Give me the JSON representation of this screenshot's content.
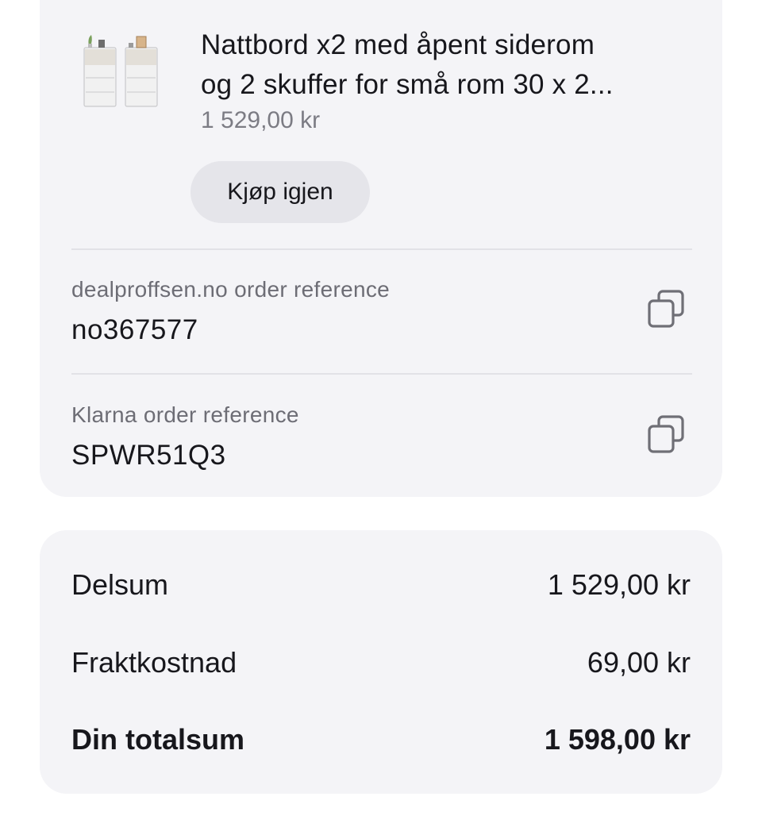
{
  "order": {
    "product": {
      "title_line1": "Nattbord x2 med åpent siderom",
      "title_line2": "og 2 skuffer for små rom 30 x 2...",
      "price": "1 529,00 kr",
      "thumbnail_icon": "nightstand-pair-icon"
    },
    "buy_again_label": "Kjøp igjen",
    "references": [
      {
        "label": "dealproffsen.no order reference",
        "value": "no367577",
        "icon": "copy-icon"
      },
      {
        "label": "Klarna order reference",
        "value": "SPWR51Q3",
        "icon": "copy-icon"
      }
    ]
  },
  "summary": {
    "subtotal_label": "Delsum",
    "subtotal_value": "1 529,00 kr",
    "shipping_label": "Fraktkostnad",
    "shipping_value": "69,00 kr",
    "total_label": "Din totalsum",
    "total_value": "1 598,00 kr"
  },
  "colors": {
    "card_background": "#f4f4f7",
    "button_background": "#e5e5ea",
    "secondary_text": "#6d6d75"
  }
}
